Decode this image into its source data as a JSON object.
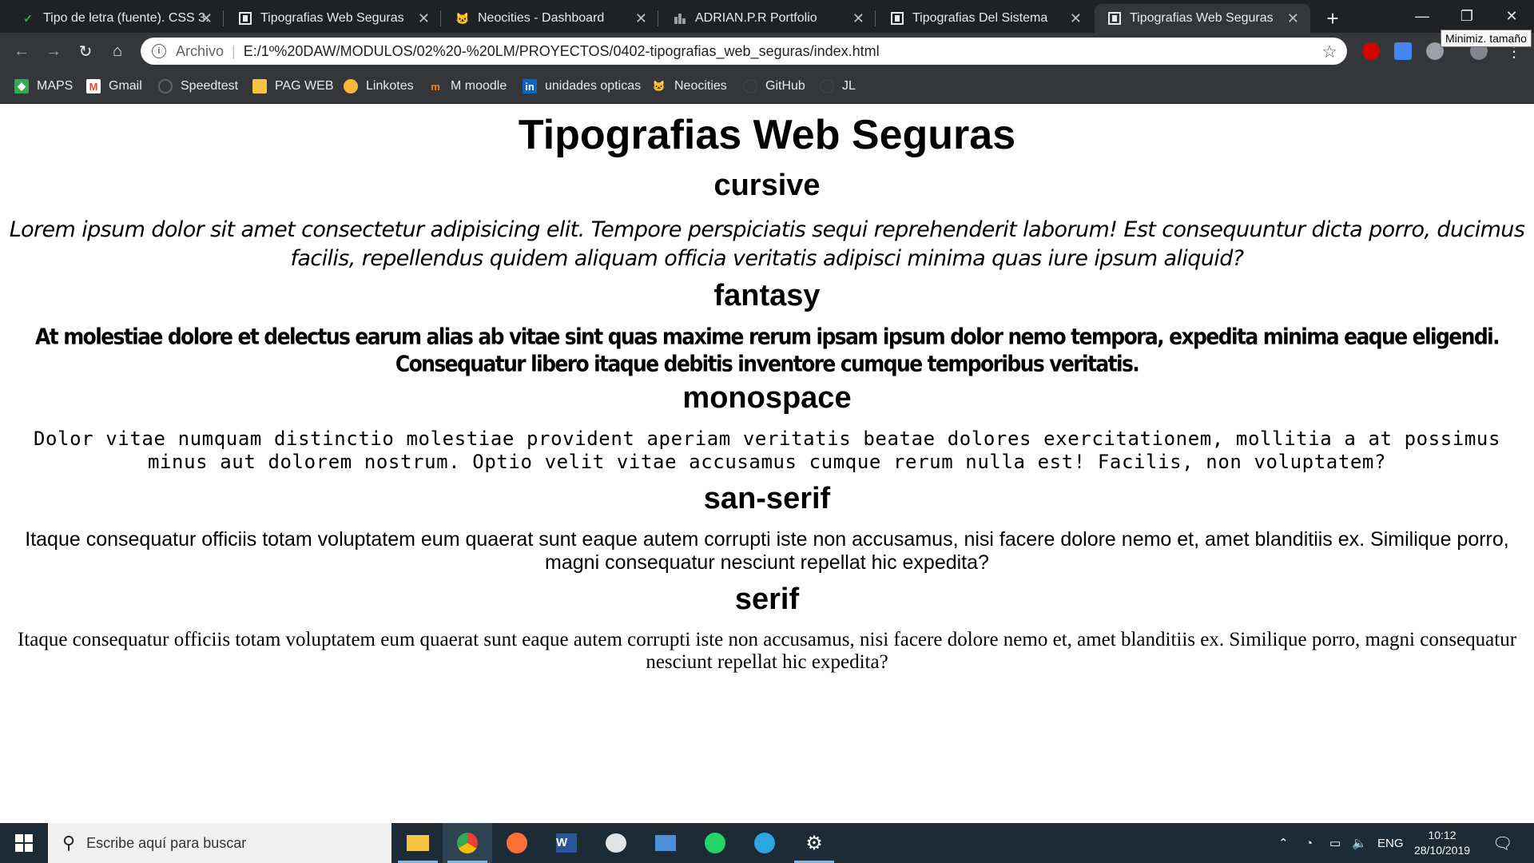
{
  "browser": {
    "tabs": [
      {
        "title": "Tipo de letra (fuente). CSS 3.",
        "favicon": "checkmark-icon",
        "active": false
      },
      {
        "title": "Tipografias Web Seguras",
        "favicon": "bracket-icon",
        "active": false
      },
      {
        "title": "Neocities - Dashboard",
        "favicon": "cat-icon",
        "active": false
      },
      {
        "title": "ADRIAN.P.R Portfolio",
        "favicon": "city-icon",
        "active": false
      },
      {
        "title": "Tipografias Del Sistema",
        "favicon": "bracket-icon",
        "active": false
      },
      {
        "title": "Tipografias Web Seguras",
        "favicon": "bracket-icon",
        "active": true
      }
    ],
    "tooltip": "Minimiz. tamaño",
    "address": {
      "scheme": "Archivo",
      "url": "E:/1º%20DAW/MODULOS/02%20-%20LM/PROYECTOS/0402-tipografias_web_seguras/index.html"
    },
    "bookmarks": [
      {
        "label": "MAPS",
        "icon": "maps-icon",
        "color": "#34a853"
      },
      {
        "label": "Gmail",
        "icon": "gmail-icon",
        "color": "#ea4335"
      },
      {
        "label": "Speedtest",
        "icon": "speedtest-icon",
        "color": "#3c4043"
      },
      {
        "label": "PAG WEB",
        "icon": "folder-icon",
        "color": "#f6c343"
      },
      {
        "label": "Linkotes",
        "icon": "linkotes-icon",
        "color": "#f6b93b"
      },
      {
        "label": "M moodle",
        "icon": "moodle-icon",
        "color": "#f98012"
      },
      {
        "label": "unidades opticas",
        "icon": "linkedin-icon",
        "color": "#0a66c2"
      },
      {
        "label": "Neocities",
        "icon": "cat-icon",
        "color": "#e8833a"
      },
      {
        "label": "GitHub",
        "icon": "github-icon",
        "color": "#3c4043"
      },
      {
        "label": "JL",
        "icon": "github-icon",
        "color": "#3c4043"
      }
    ]
  },
  "page": {
    "title": "Tipografias Web Seguras",
    "sections": [
      {
        "heading": "cursive",
        "text": "Lorem ipsum dolor sit amet consectetur adipisicing elit. Tempore perspiciatis sequi reprehenderit laborum! Est consequuntur dicta porro, ducimus facilis, repellendus quidem aliquam officia veritatis adipisci minima quas iure ipsum aliquid?"
      },
      {
        "heading": "fantasy",
        "text": "At molestiae dolore et delectus earum alias ab vitae sint quas maxime rerum ipsam ipsum dolor nemo tempora, expedita minima eaque eligendi. Consequatur libero itaque debitis inventore cumque temporibus veritatis."
      },
      {
        "heading": "monospace",
        "text": "Dolor vitae numquam distinctio molestiae provident aperiam veritatis beatae dolores exercitationem, mollitia a at possimus minus aut dolorem nostrum. Optio velit vitae accusamus cumque rerum nulla est! Facilis, non voluptatem?"
      },
      {
        "heading": "san-serif",
        "text": "Itaque consequatur officiis totam voluptatem eum quaerat sunt eaque autem corrupti iste non accusamus, nisi facere dolore nemo et, amet blanditiis ex. Similique porro, magni consequatur nesciunt repellat hic expedita?"
      },
      {
        "heading": "serif",
        "text": "Itaque consequatur officiis totam voluptatem eum quaerat sunt eaque autem corrupti iste non accusamus, nisi facere dolore nemo et, amet blanditiis ex. Similique porro, magni consequatur nesciunt repellat hic expedita?"
      }
    ]
  },
  "taskbar": {
    "search_placeholder": "Escribe aquí para buscar",
    "language": "ENG",
    "time": "10:12",
    "date": "28/10/2019"
  }
}
